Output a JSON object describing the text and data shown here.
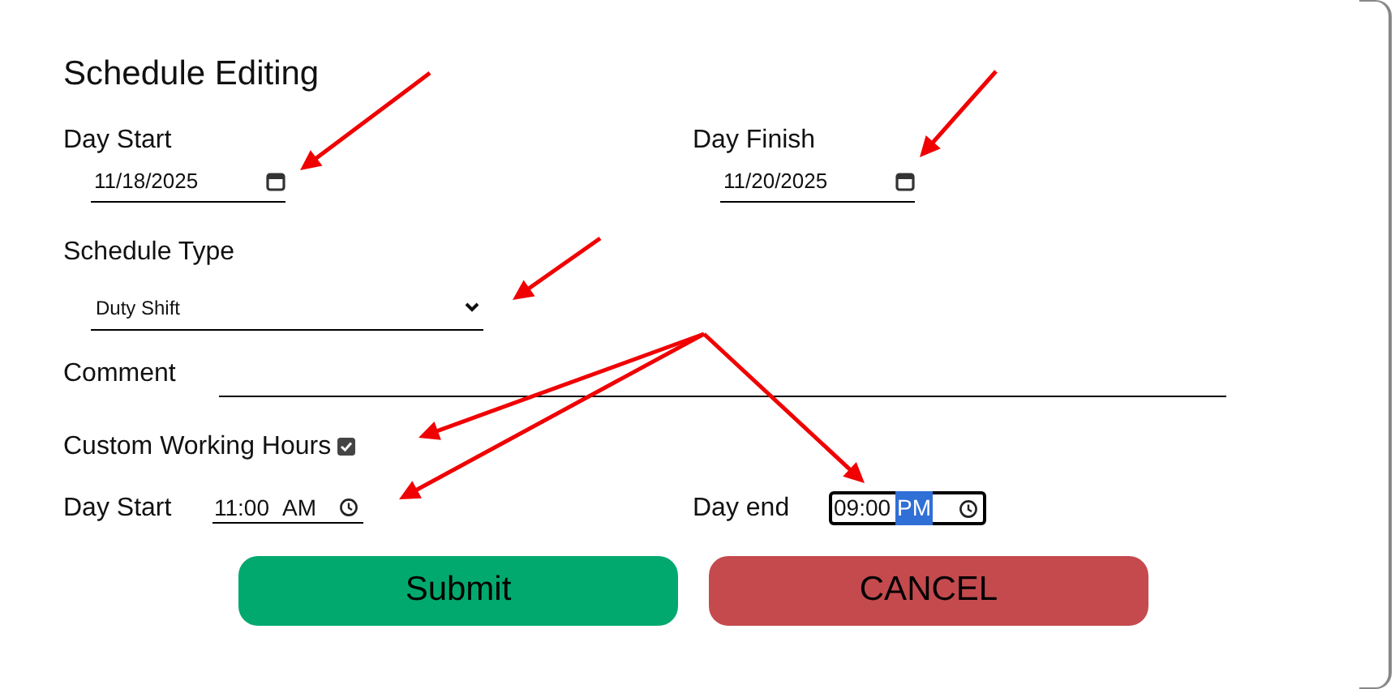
{
  "dialog": {
    "title": "Schedule Editing"
  },
  "day_start": {
    "label": "Day Start",
    "value": "11/18/2025"
  },
  "day_finish": {
    "label": "Day Finish",
    "value": "11/20/2025"
  },
  "schedule_type": {
    "label": "Schedule Type",
    "value": "Duty Shift"
  },
  "comment": {
    "label": "Comment"
  },
  "custom_hours": {
    "label": "Custom Working Hours",
    "checked": true
  },
  "time_start": {
    "label": "Day Start",
    "time": "11:00",
    "period": "AM",
    "focused": false,
    "period_selected": false
  },
  "time_end": {
    "label": "Day end",
    "time": "09:00",
    "period": "PM",
    "focused": true,
    "period_selected": true
  },
  "buttons": [
    {
      "label": "Submit",
      "kind": "primary"
    },
    {
      "label": "CANCEL",
      "kind": "danger"
    }
  ]
}
